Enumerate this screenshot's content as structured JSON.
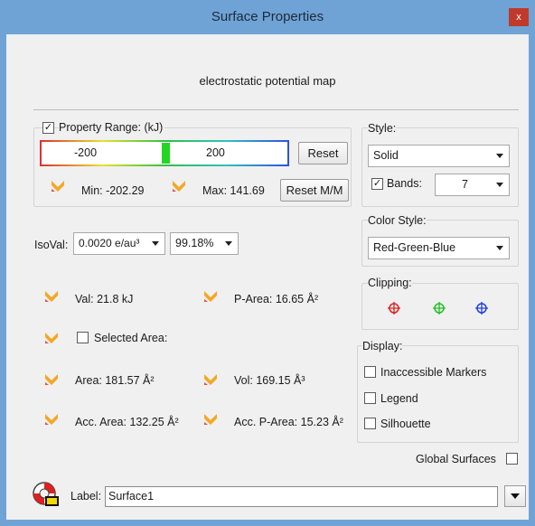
{
  "window": {
    "title": "Surface Properties",
    "close_glyph": "x"
  },
  "surface_type": "electrostatic potential map",
  "property_range": {
    "checked": true,
    "label": "Property Range: (kJ)",
    "min_value": "-200",
    "max_value": "200",
    "reset_label": "Reset",
    "min_text": "Min: -202.29",
    "max_text": "Max: 141.69",
    "reset_mm_label": "Reset M/M"
  },
  "style": {
    "group_label": "Style:",
    "style_value": "Solid",
    "bands_checked": true,
    "bands_label": "Bands:",
    "bands_value": "7"
  },
  "color_style": {
    "group_label": "Color Style:",
    "value": "Red-Green-Blue"
  },
  "isoval": {
    "label": "IsoVal:",
    "value": "0.0020 e/au³",
    "percent": "99.18%"
  },
  "clipping": {
    "group_label": "Clipping:",
    "icons": [
      "red-crosshair-icon",
      "green-crosshair-icon",
      "blue-crosshair-icon"
    ]
  },
  "measures": {
    "val": "Val: 21.8  kJ",
    "p_area": "P-Area: 16.65 Å²",
    "selected_area_label": "Selected Area:",
    "area": "Area: 181.57 Å²",
    "vol": "Vol: 169.15 Å³",
    "acc_area": "Acc. Area: 132.25 Å²",
    "acc_p_area": "Acc. P-Area: 15.23 Å²"
  },
  "display": {
    "group_label": "Display:",
    "inaccessible_markers": "Inaccessible Markers",
    "legend": "Legend",
    "silhouette": "Silhouette"
  },
  "global_surfaces_label": "Global Surfaces",
  "label_field": {
    "label": "Label:",
    "value": "Surface1"
  },
  "colors": {
    "title_bar": "#6fa3d6",
    "close": "#c0392b",
    "arrow_icon": "#f5a623",
    "slider_thumb": "#22d622"
  }
}
